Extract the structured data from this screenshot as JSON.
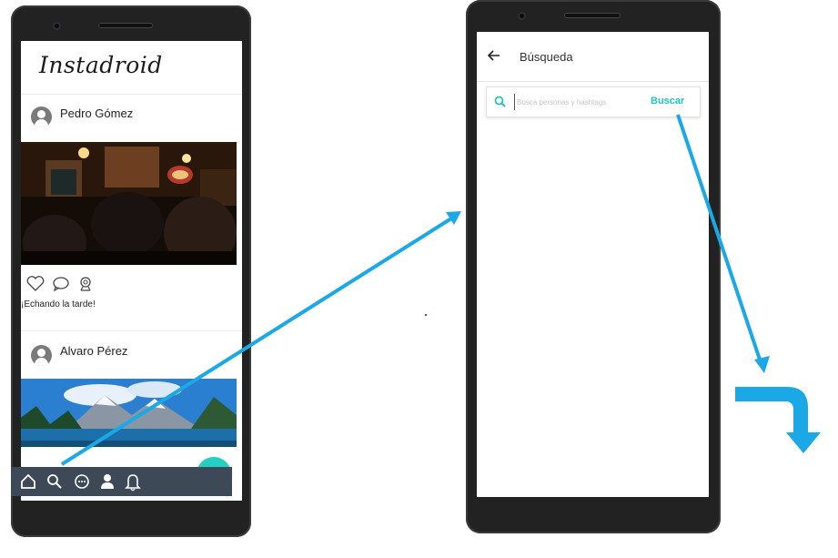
{
  "left_screen": {
    "app_title": "Instadroid",
    "posts": [
      {
        "user": "Pedro Gómez",
        "caption": "¡Echando la tarde!"
      },
      {
        "user": "Alvaro Pérez",
        "caption": ""
      }
    ],
    "fab_label": "+",
    "nav_icons": [
      "home-icon",
      "search-icon",
      "chat-icon",
      "profile-icon",
      "bell-icon"
    ]
  },
  "right_screen": {
    "title": "Búsqueda",
    "search": {
      "placeholder": "Busca personas y hashtags",
      "value": "",
      "button_label": "Buscar"
    }
  },
  "colors": {
    "accent": "#23d0c2",
    "arrow": "#1aa9e6",
    "nav_bg": "#3d4957"
  }
}
